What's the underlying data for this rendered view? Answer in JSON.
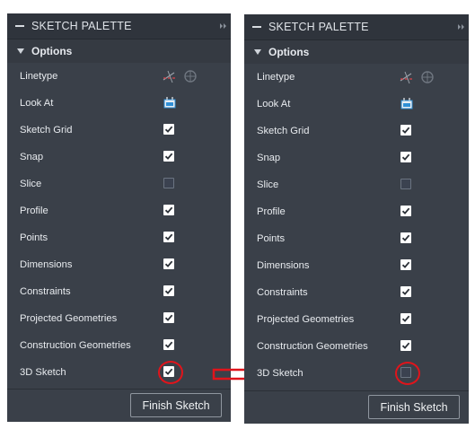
{
  "left_panel": {
    "title": "SKETCH PALETTE",
    "section": "Options",
    "rows": [
      {
        "label": "Linetype",
        "control": "linetype-icon"
      },
      {
        "label": "Look At",
        "control": "look-at-icon"
      },
      {
        "label": "Sketch Grid",
        "checked": true
      },
      {
        "label": "Snap",
        "checked": true
      },
      {
        "label": "Slice",
        "checked": false
      },
      {
        "label": "Profile",
        "checked": true
      },
      {
        "label": "Points",
        "checked": true
      },
      {
        "label": "Dimensions",
        "checked": true
      },
      {
        "label": "Constraints",
        "checked": true
      },
      {
        "label": "Projected Geometries",
        "checked": true
      },
      {
        "label": "Construction Geometries",
        "checked": true
      },
      {
        "label": "3D Sketch",
        "checked": true
      }
    ],
    "finish_label": "Finish Sketch"
  },
  "right_panel": {
    "title": "SKETCH PALETTE",
    "section": "Options",
    "rows": [
      {
        "label": "Linetype",
        "control": "linetype-icon"
      },
      {
        "label": "Look At",
        "control": "look-at-icon"
      },
      {
        "label": "Sketch Grid",
        "checked": true
      },
      {
        "label": "Snap",
        "checked": true
      },
      {
        "label": "Slice",
        "checked": false
      },
      {
        "label": "Profile",
        "checked": true
      },
      {
        "label": "Points",
        "checked": true
      },
      {
        "label": "Dimensions",
        "checked": true
      },
      {
        "label": "Constraints",
        "checked": true
      },
      {
        "label": "Projected Geometries",
        "checked": true
      },
      {
        "label": "Construction Geometries",
        "checked": true
      },
      {
        "label": "3D Sketch",
        "checked": false
      }
    ],
    "finish_label": "Finish Sketch"
  },
  "colors": {
    "panel_bg": "#3a4049",
    "header_bg": "#2f343c",
    "highlight_red": "#e0141b",
    "lookat_blue": "#2f8fd6"
  }
}
